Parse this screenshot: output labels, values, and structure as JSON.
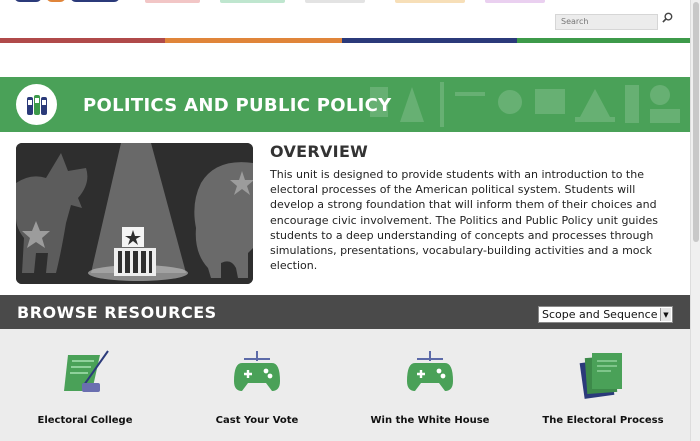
{
  "header": {
    "search": {
      "placeholder": "Search",
      "icon": "search-icon"
    },
    "stripe_colors": [
      "#b04a4a",
      "#e0853a",
      "#2b3a7a",
      "#3d9a4a"
    ]
  },
  "banner": {
    "title": "POLITICS AND PUBLIC POLICY",
    "icon": "phones-icon",
    "color": "#4aa158"
  },
  "overview": {
    "title": "OVERVIEW",
    "text": "This unit is designed to provide students with an introduction to the electoral processes of the American political system. Students will develop a strong foundation that will inform them of their choices and encourage civic involvement. The Politics and Public Policy unit guides students to a deep understanding of concepts and processes through simulations, presentations, vocabulary-building activities and a mock election."
  },
  "browse": {
    "title": "BROWSE RESOURCES",
    "select_value": "Scope and Sequence"
  },
  "resources": [
    {
      "label": "Electoral College",
      "icon": "document-pen-icon"
    },
    {
      "label": "Cast Your Vote",
      "icon": "game-controller-icon"
    },
    {
      "label": "Win the White House",
      "icon": "game-controller-icon"
    },
    {
      "label": "The Electoral Process",
      "icon": "book-icon"
    }
  ]
}
